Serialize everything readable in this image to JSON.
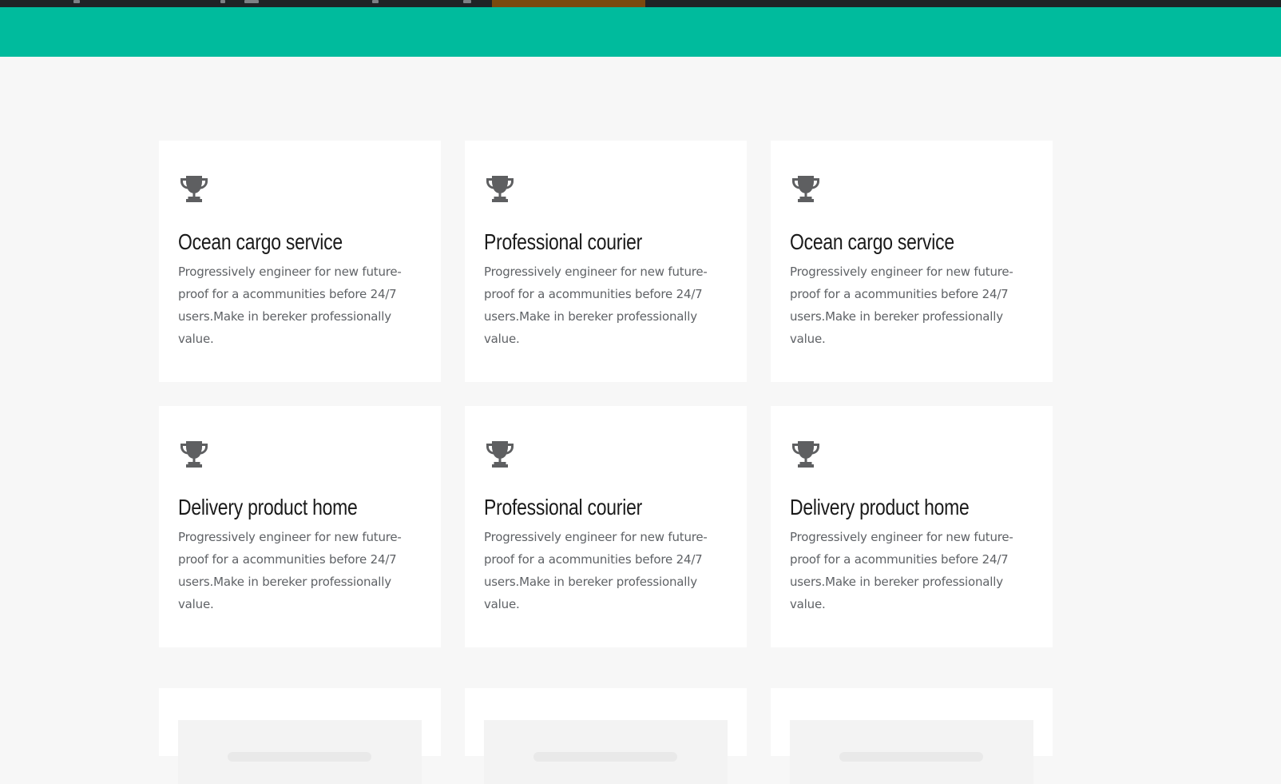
{
  "colors": {
    "banner": "#00bb9d",
    "topbar": "#1f2326",
    "topbar_accent": "#7a4a0e",
    "icon": "#5e5f61"
  },
  "services": [
    {
      "icon": "trophy-icon",
      "title": "Ocean cargo service",
      "description": "Progressively engineer for new future-proof for a acommunities before 24/7 users.Make in bereker professionally value."
    },
    {
      "icon": "trophy-icon",
      "title": "Professional courier",
      "description": "Progressively engineer for new future-proof for a acommunities before 24/7 users.Make in bereker professionally value."
    },
    {
      "icon": "trophy-icon",
      "title": "Ocean cargo service",
      "description": "Progressively engineer for new future-proof for a acommunities before 24/7 users.Make in bereker professionally value."
    },
    {
      "icon": "trophy-icon",
      "title": "Delivery product home",
      "description": "Progressively engineer for new future-proof for a acommunities before 24/7 users.Make in bereker professionally value."
    },
    {
      "icon": "trophy-icon",
      "title": "Professional courier",
      "description": "Progressively engineer for new future-proof for a acommunities before 24/7 users.Make in bereker professionally value."
    },
    {
      "icon": "trophy-icon",
      "title": "Delivery product home",
      "description": "Progressively engineer for new future-proof for a acommunities before 24/7 users.Make in bereker professionally value."
    }
  ]
}
